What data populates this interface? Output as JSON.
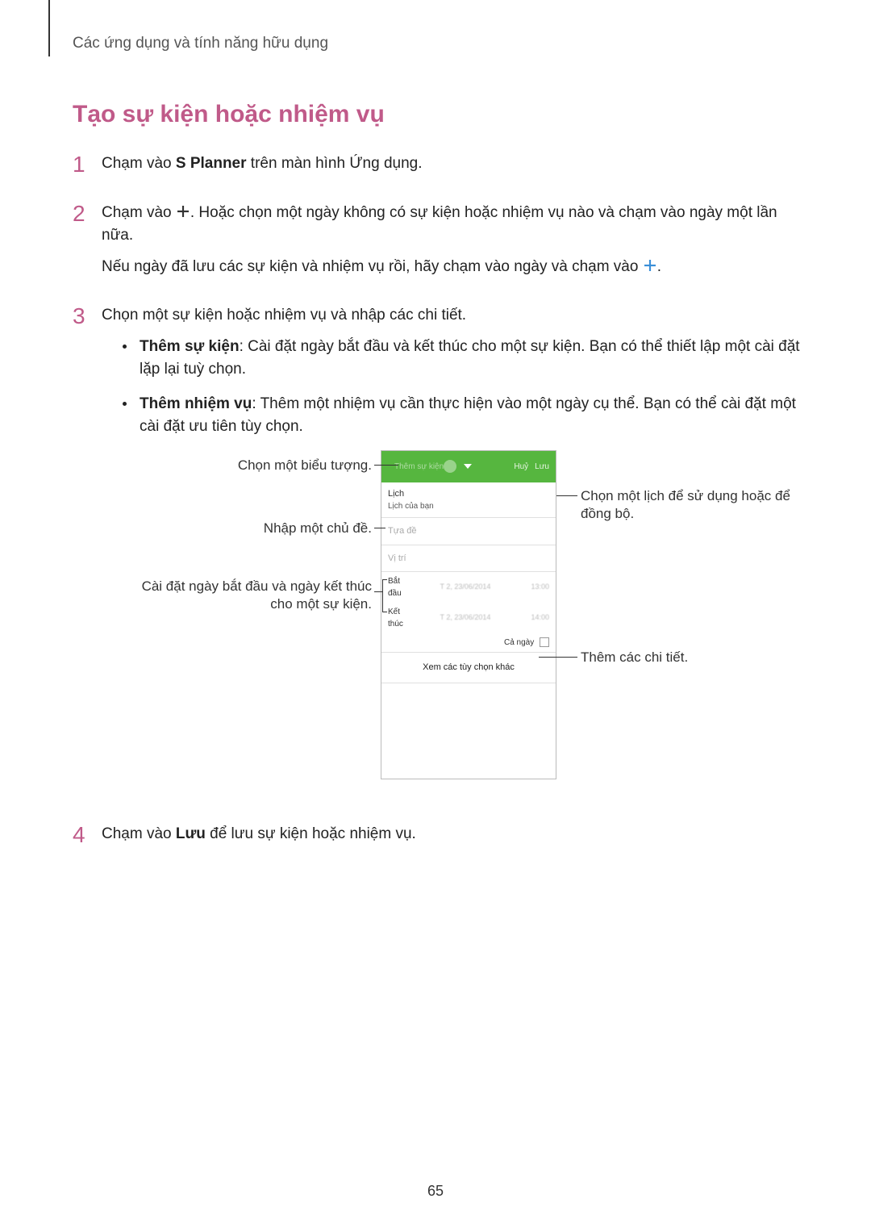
{
  "chapter": "Các ứng dụng và tính năng hữu dụng",
  "section_title": "Tạo sự kiện hoặc nhiệm vụ",
  "steps": {
    "s1": {
      "num": "1",
      "pre": "Chạm vào ",
      "bold": "S Planner",
      "post": " trên màn hình Ứng dụng."
    },
    "s2": {
      "num": "2",
      "line1_pre": "Chạm vào ",
      "line1_post": ". Hoặc chọn một ngày không có sự kiện hoặc nhiệm vụ nào và chạm vào ngày một lần nữa.",
      "line2_pre": "Nếu ngày đã lưu các sự kiện và nhiệm vụ rồi, hãy chạm vào ngày và chạm vào ",
      "line2_post": "."
    },
    "s3": {
      "num": "3",
      "intro": "Chọn một sự kiện hoặc nhiệm vụ và nhập các chi tiết.",
      "b1_bold": "Thêm sự kiện",
      "b1_rest": ": Cài đặt ngày bắt đầu và kết thúc cho một sự kiện. Bạn có thể thiết lập một cài đặt lặp lại tuỳ chọn.",
      "b2_bold": "Thêm nhiệm vụ",
      "b2_rest": ": Thêm một nhiệm vụ cần thực hiện vào một ngày cụ thể. Bạn có thể cài đặt một cài đặt ưu tiên tùy chọn."
    },
    "s4": {
      "num": "4",
      "pre": "Chạm vào ",
      "bold": "Lưu",
      "post": " để lưu sự kiện hoặc nhiệm vụ."
    }
  },
  "callouts": {
    "emoji": "Chọn một biểu tượng.",
    "title": "Nhập một chủ đề.",
    "dates": "Cài đặt ngày bắt đầu và ngày kết thúc cho một sự kiện.",
    "calendar": "Chọn một lịch để sử dụng hoặc để đồng bộ.",
    "more": "Thêm các chi tiết."
  },
  "phone": {
    "hdr_event": "Thêm sự kiện",
    "hdr_cancel": "Huỷ",
    "hdr_save": "Lưu",
    "cal_label": "Lịch",
    "cal_sub": "Lịch của bạn",
    "title_ph": "Tựa đề",
    "loc_ph": "Vị trí",
    "start": "Bắt đầu",
    "end": "Kết thúc",
    "allday": "Cả ngày",
    "more": "Xem các tùy chọn khác"
  },
  "page_number": "65"
}
